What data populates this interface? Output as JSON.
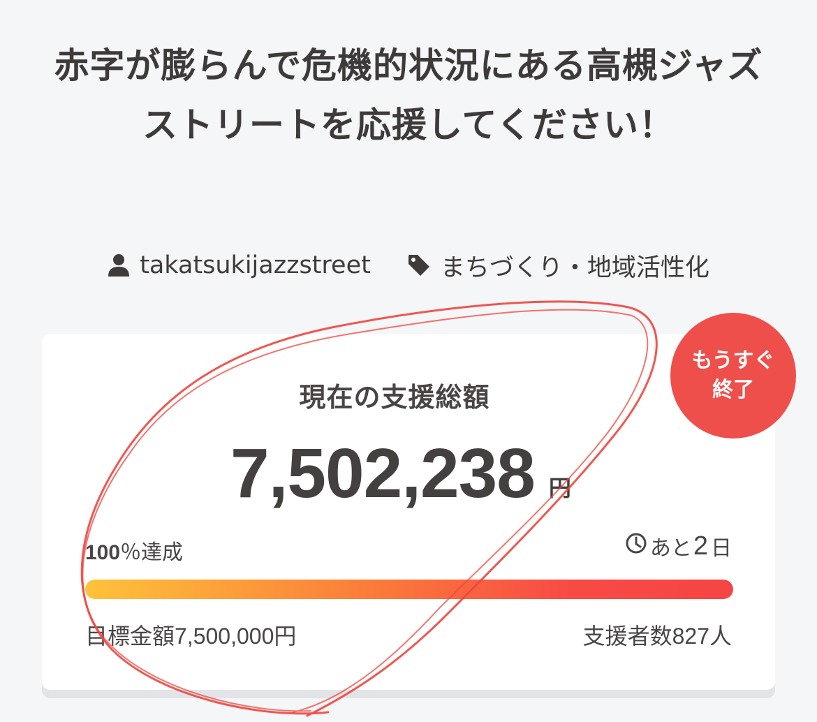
{
  "project": {
    "title": "赤字が膨らんで危機的状況にある高槻ジャズストリートを応援してください！",
    "owner": "takatsukijazzstreet",
    "owner_icon": "user-icon",
    "category": "まちづくり・地域活性化",
    "category_icon": "tag-icon"
  },
  "funding": {
    "heading": "現在の支援総額",
    "amount": "7,502,238",
    "currency_unit": "円",
    "achievement_value": "100",
    "achievement_suffix": "％達成",
    "progress_fraction": 1.0,
    "remaining_prefix": "あと",
    "remaining_days": "2",
    "remaining_suffix": "日",
    "remaining_icon": "clock-icon",
    "goal_label": "目標金額7,500,000円",
    "backers_label": "支援者数827人"
  },
  "badge": {
    "label": "もうすぐ\n終了",
    "color": "#ef4f4b"
  },
  "colors": {
    "progress_start": "#ffc23a",
    "progress_end": "#f54544",
    "annotation_stroke": "#f0453e"
  }
}
